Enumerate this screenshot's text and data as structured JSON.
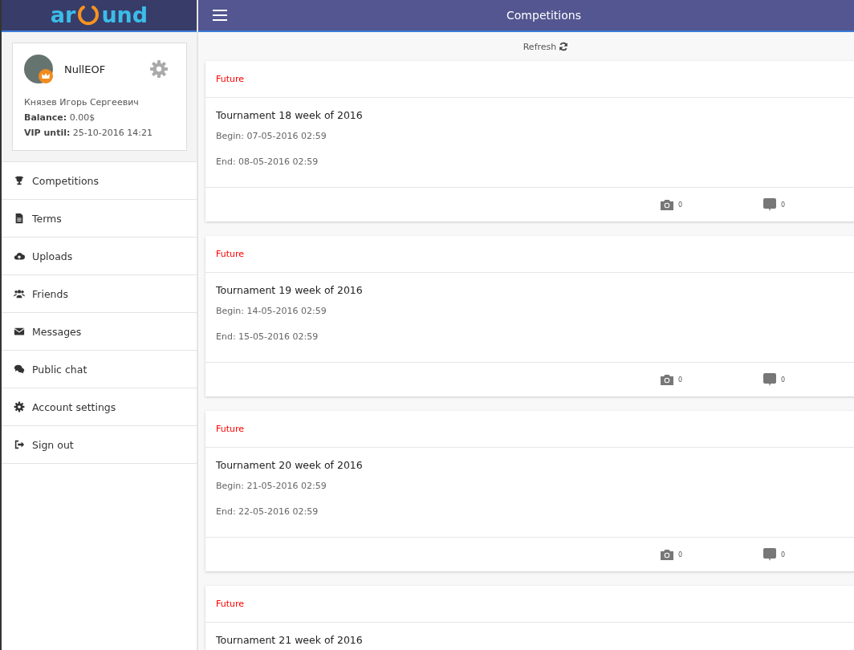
{
  "sidebar": {
    "logo": {
      "left": "ar",
      "right": "und"
    },
    "profile": {
      "username": "NullEOF",
      "vip": true,
      "full_name": "Князев Игорь Сергеевич",
      "balance_label": "Balance:",
      "balance": "0.00$",
      "vip_label": "VIP until:",
      "vip_until": "25-10-2016 14:21"
    },
    "items": [
      {
        "label": "Competitions"
      },
      {
        "label": "Terms"
      },
      {
        "label": "Uploads"
      },
      {
        "label": "Friends"
      },
      {
        "label": "Messages"
      },
      {
        "label": "Public chat"
      },
      {
        "label": "Account settings"
      },
      {
        "label": "Sign out"
      }
    ]
  },
  "header": {
    "title": "Competitions"
  },
  "refresh": "Refresh",
  "competitions": [
    {
      "status": "Future",
      "title": "Tournament 18 week of 2016",
      "begin": "Begin: 07-05-2016 02:59",
      "end": "End: 08-05-2016 02:59",
      "photos": "0",
      "comments": "0"
    },
    {
      "status": "Future",
      "title": "Tournament 19 week of 2016",
      "begin": "Begin: 14-05-2016 02:59",
      "end": "End: 15-05-2016 02:59",
      "photos": "0",
      "comments": "0"
    },
    {
      "status": "Future",
      "title": "Tournament 20 week of 2016",
      "begin": "Begin: 21-05-2016 02:59",
      "end": "End: 22-05-2016 02:59",
      "photos": "0",
      "comments": "0"
    },
    {
      "status": "Future",
      "title": "Tournament 21 week of 2016"
    }
  ]
}
